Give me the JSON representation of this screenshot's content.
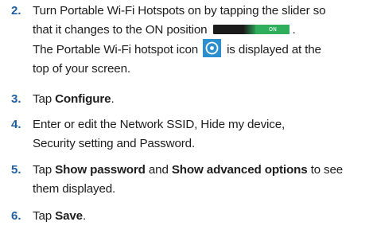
{
  "steps": [
    {
      "number": "2.",
      "lines": [
        "Turn Portable Wi-Fi Hotspots on by tapping the slider so",
        "that it changes to the ON position",
        ".",
        "The Portable Wi-Fi hotspot icon",
        "is displayed at the",
        "top of your screen."
      ],
      "slider_label": "ON"
    },
    {
      "number": "3.",
      "prefix": "Tap ",
      "bold": "Configure",
      "suffix": "."
    },
    {
      "number": "4.",
      "lines": [
        "Enter or edit the Network SSID, Hide my device,",
        "Security setting and Password."
      ]
    },
    {
      "number": "5.",
      "prefix": "Tap ",
      "bold1": "Show password",
      "middle": " and ",
      "bold2": "Show advanced options",
      "suffix1": " to see",
      "line2": "them displayed."
    },
    {
      "number": "6.",
      "prefix": "Tap ",
      "bold": "Save",
      "suffix": "."
    }
  ],
  "colors": {
    "step_number": "#1c5fa8",
    "slider_on": "#2fae5c",
    "slider_off": "#1b1b1b",
    "hotspot_icon_bg": "#2b8fcf"
  },
  "icons": {
    "slider": "on-off-slider-icon",
    "hotspot": "portable-wifi-hotspot-icon"
  }
}
